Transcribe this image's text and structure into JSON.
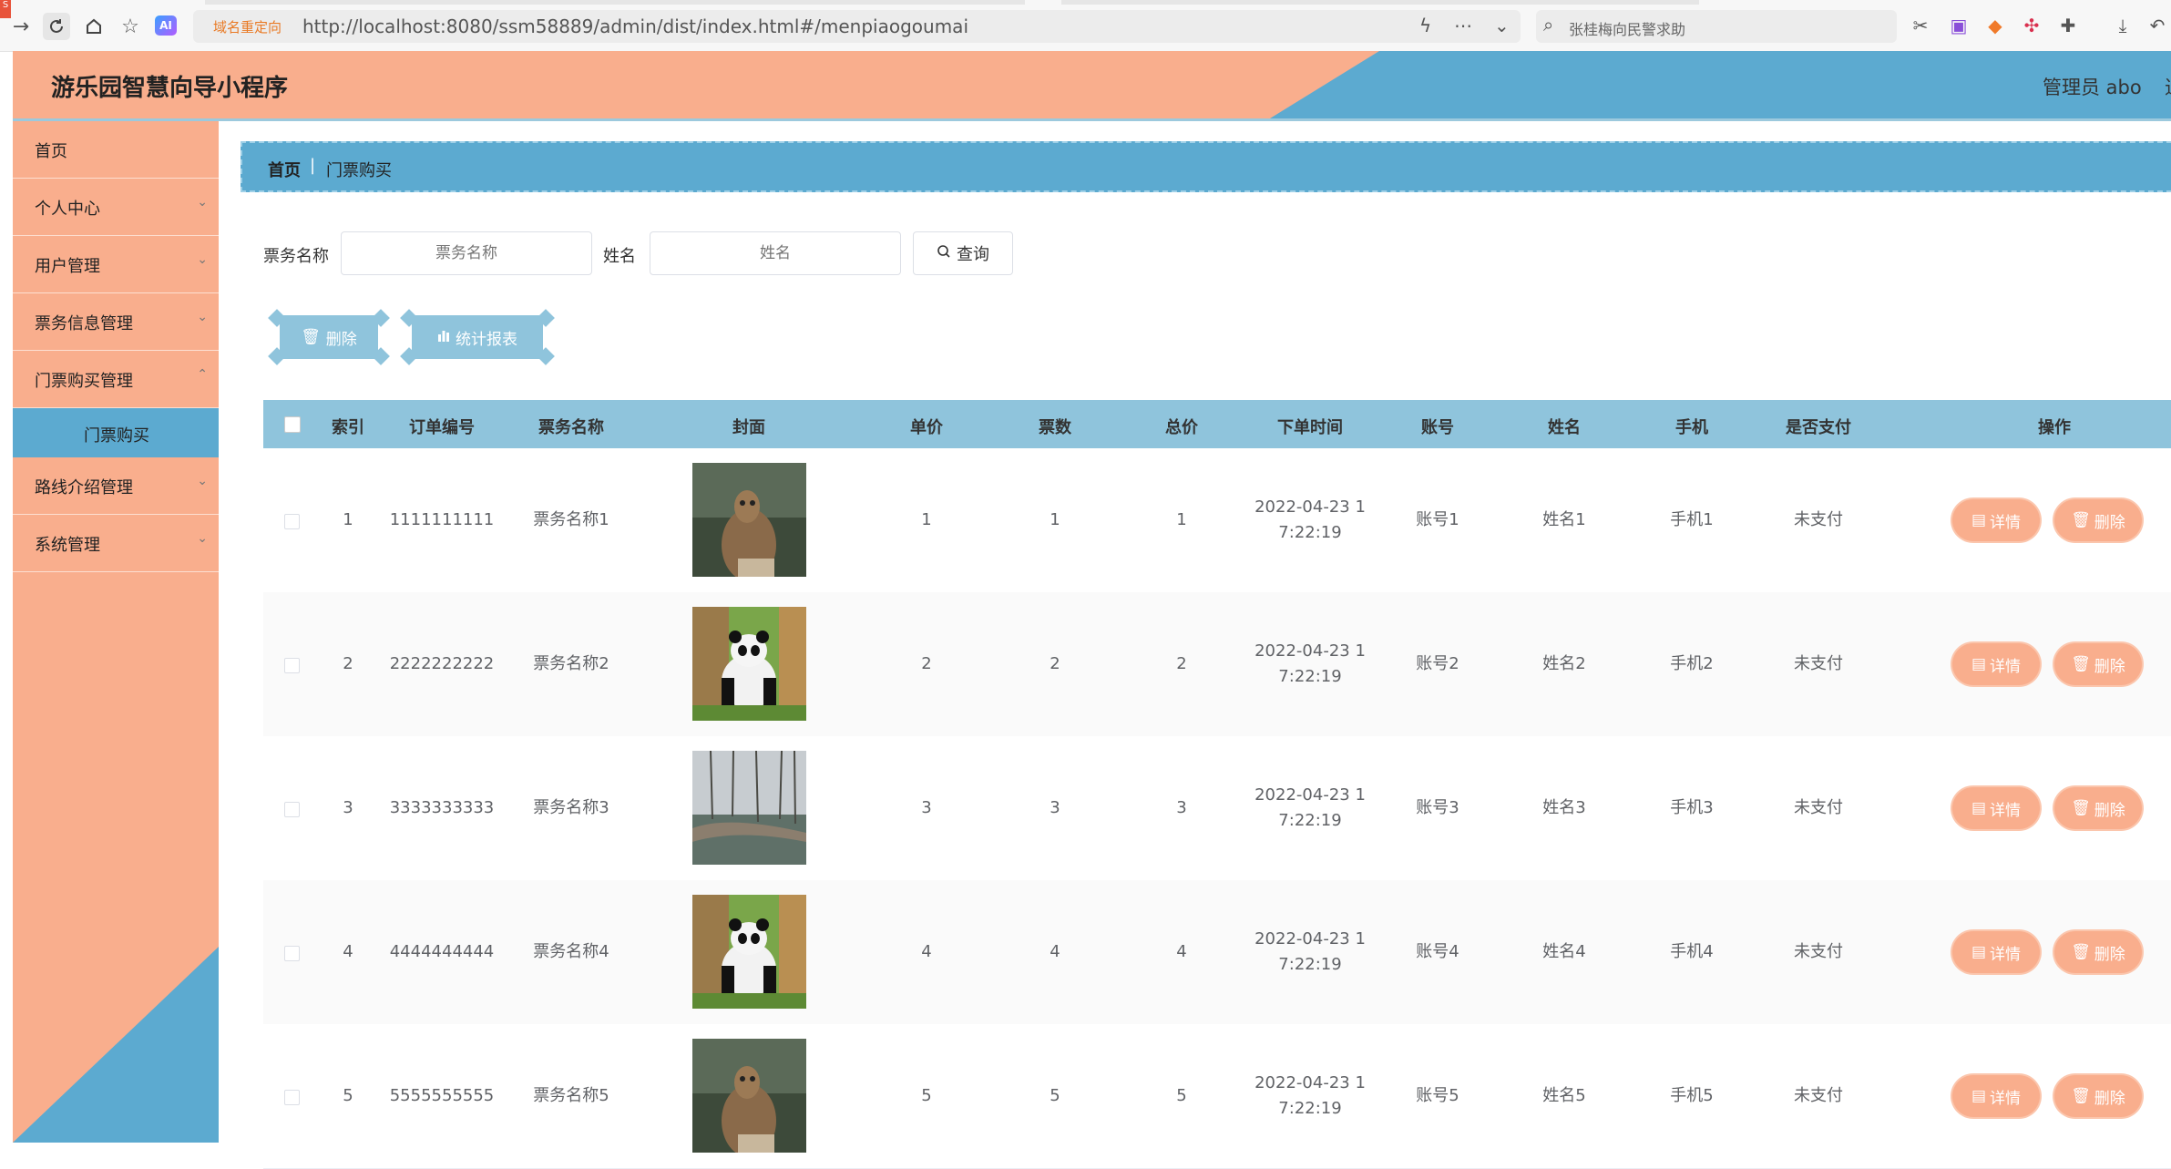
{
  "browser": {
    "tag": "S",
    "redirect_label": "域名重定向",
    "url": "http://localhost:8080/ssm58889/admin/dist/index.html#/menpiaogoumai",
    "search_text": "张桂梅向民警求助",
    "ai_label": "AI"
  },
  "header": {
    "title": "游乐园智慧向导小程序",
    "admin": "管理员 abo",
    "extra": "退"
  },
  "sidebar": {
    "items": [
      {
        "label": "首页"
      },
      {
        "label": "个人中心"
      },
      {
        "label": "用户管理"
      },
      {
        "label": "票务信息管理"
      },
      {
        "label": "门票购买管理"
      },
      {
        "label": "路线介绍管理"
      },
      {
        "label": "系统管理"
      }
    ],
    "active_sub": "门票购买"
  },
  "breadcrumb": {
    "home": "首页",
    "separator": "|",
    "current": "门票购买"
  },
  "search": {
    "ticket_label": "票务名称",
    "ticket_placeholder": "票务名称",
    "name_label": "姓名",
    "name_placeholder": "姓名",
    "query_label": "查询"
  },
  "actions": {
    "delete_label": "删除",
    "stats_label": "统计报表"
  },
  "table": {
    "columns": [
      "索引",
      "订单编号",
      "票务名称",
      "封面",
      "单价",
      "票数",
      "总价",
      "下单时间",
      "账号",
      "姓名",
      "手机",
      "是否支付",
      "操作"
    ],
    "detail_label": "详情",
    "delete_label": "删除",
    "rows": [
      {
        "index": "1",
        "order_no": "1111111111",
        "ticket_name": "票务名称1",
        "cover": "meerkat",
        "price": "1",
        "count": "1",
        "total": "1",
        "time_line1": "2022-04-23 1",
        "time_line2": "7:22:19",
        "account": "账号1",
        "name": "姓名1",
        "phone": "手机1",
        "paid": "未支付"
      },
      {
        "index": "2",
        "order_no": "2222222222",
        "ticket_name": "票务名称2",
        "cover": "panda",
        "price": "2",
        "count": "2",
        "total": "2",
        "time_line1": "2022-04-23 1",
        "time_line2": "7:22:19",
        "account": "账号2",
        "name": "姓名2",
        "phone": "手机2",
        "paid": "未支付"
      },
      {
        "index": "3",
        "order_no": "3333333333",
        "ticket_name": "票务名称3",
        "cover": "park",
        "price": "3",
        "count": "3",
        "total": "3",
        "time_line1": "2022-04-23 1",
        "time_line2": "7:22:19",
        "account": "账号3",
        "name": "姓名3",
        "phone": "手机3",
        "paid": "未支付"
      },
      {
        "index": "4",
        "order_no": "4444444444",
        "ticket_name": "票务名称4",
        "cover": "panda",
        "price": "4",
        "count": "4",
        "total": "4",
        "time_line1": "2022-04-23 1",
        "time_line2": "7:22:19",
        "account": "账号4",
        "name": "姓名4",
        "phone": "手机4",
        "paid": "未支付"
      },
      {
        "index": "5",
        "order_no": "5555555555",
        "ticket_name": "票务名称5",
        "cover": "meerkat",
        "price": "5",
        "count": "5",
        "total": "5",
        "time_line1": "2022-04-23 1",
        "time_line2": "7:22:19",
        "account": "账号5",
        "name": "姓名5",
        "phone": "手机5",
        "paid": "未支付"
      }
    ]
  },
  "colors": {
    "peach": "#f9ae8d",
    "blue": "#5caad0",
    "light_blue": "#8fc4dc"
  }
}
